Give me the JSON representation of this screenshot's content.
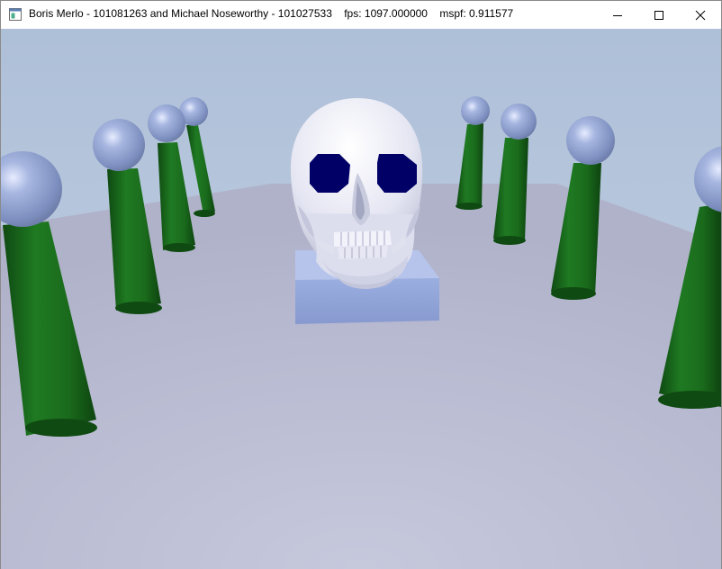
{
  "window": {
    "title": "Boris Merlo - 101081263 and Michael Noseworthy - 101027533",
    "fps_label": "fps:",
    "fps_value": "1097.000000",
    "mspf_label": "mspf:",
    "mspf_value": "0.911577",
    "app_icon": "application-window-icon",
    "controls": [
      "minimize-icon",
      "maximize-icon",
      "close-icon"
    ]
  },
  "scene": {
    "sky_color": "#b4c6db",
    "floor_color": "#bcbfd6",
    "pillar_color": "#1d6d1d",
    "sphere_color": "#98a9d8",
    "pedestal_color": "#8fa2d4",
    "skull_color": "#e8e9f4",
    "eye_color": "#000066"
  }
}
